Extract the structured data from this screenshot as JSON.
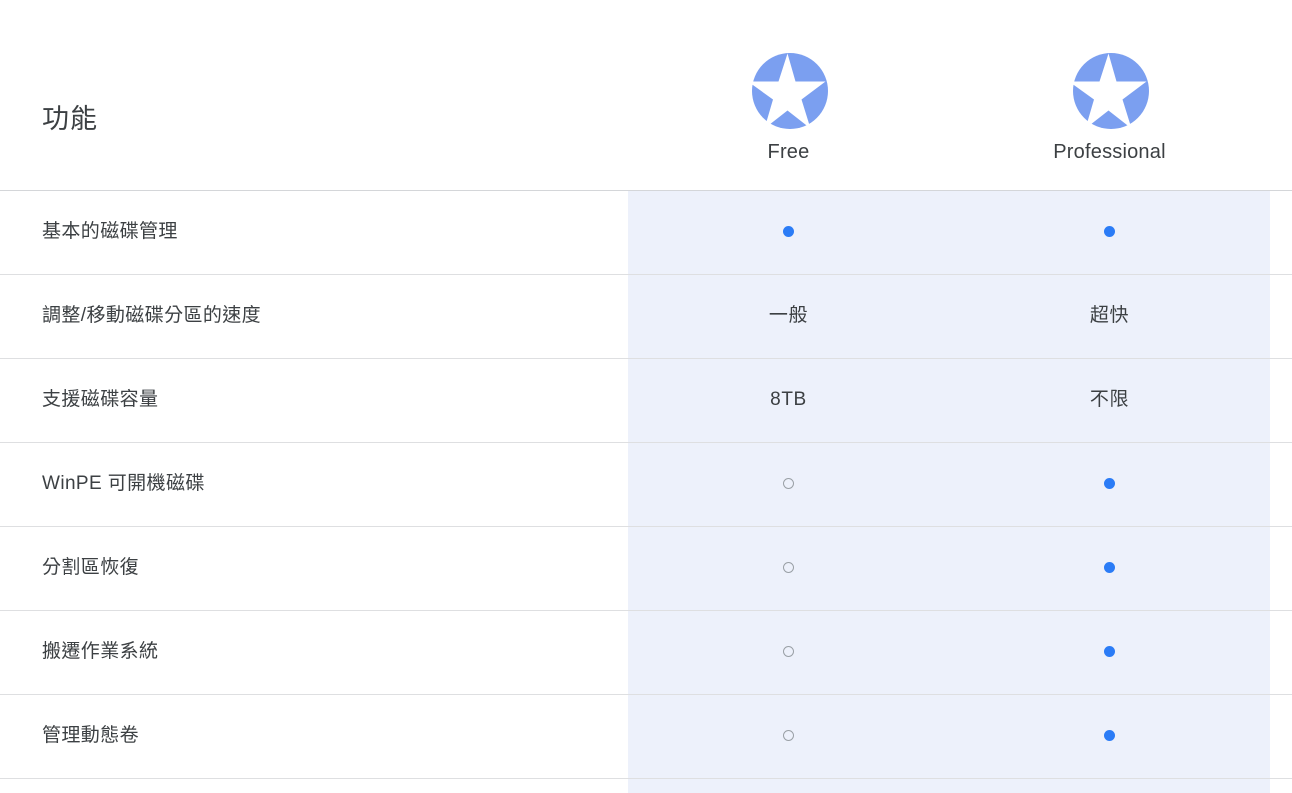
{
  "header": {
    "feature_column_title": "功能",
    "plans": [
      {
        "name": "Free",
        "icon": "star-badge-icon",
        "icon_color": "#7b9ff0"
      },
      {
        "name": "Professional",
        "icon": "star-badge-icon",
        "icon_color": "#7b9ff0"
      }
    ]
  },
  "colors": {
    "highlight_band": "#edf1fb",
    "mark_yes": "#2b7cf6",
    "mark_no_border": "#9aa0a6",
    "divider": "#dedfe1",
    "text": "#3c4043",
    "icon_blue": "#7b9ff0"
  },
  "table": {
    "columns": [
      "功能",
      "Free",
      "Professional"
    ],
    "rows": [
      {
        "feature": "基本的磁碟管理",
        "free": {
          "type": "dot-filled",
          "text": ""
        },
        "professional": {
          "type": "dot-filled",
          "text": ""
        }
      },
      {
        "feature": "調整/移動磁碟分區的速度",
        "free": {
          "type": "text",
          "text": "一般"
        },
        "professional": {
          "type": "text",
          "text": "超快"
        }
      },
      {
        "feature": "支援磁碟容量",
        "free": {
          "type": "text",
          "text": "8TB"
        },
        "professional": {
          "type": "text",
          "text": "不限"
        }
      },
      {
        "feature": "WinPE 可開機磁碟",
        "free": {
          "type": "dot-empty",
          "text": ""
        },
        "professional": {
          "type": "dot-filled",
          "text": ""
        }
      },
      {
        "feature": "分割區恢復",
        "free": {
          "type": "dot-empty",
          "text": ""
        },
        "professional": {
          "type": "dot-filled",
          "text": ""
        }
      },
      {
        "feature": "搬遷作業系統",
        "free": {
          "type": "dot-empty",
          "text": ""
        },
        "professional": {
          "type": "dot-filled",
          "text": ""
        }
      },
      {
        "feature": "管理動態卷",
        "free": {
          "type": "dot-empty",
          "text": ""
        },
        "professional": {
          "type": "dot-filled",
          "text": ""
        }
      }
    ]
  }
}
